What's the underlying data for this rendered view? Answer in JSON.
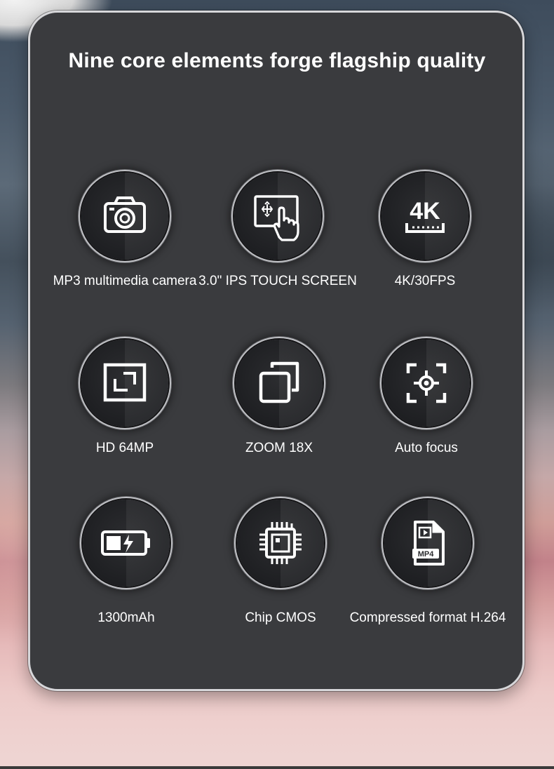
{
  "title": "Nine core elements forge flagship quality",
  "features": [
    {
      "label": "MP3 multimedia camera",
      "icon": "camera-icon"
    },
    {
      "label": "3.0\" IPS TOUCH SCREEN",
      "icon": "touch-screen-icon"
    },
    {
      "label": "4K/30FPS",
      "icon": "4k-icon"
    },
    {
      "label": "HD 64MP",
      "icon": "frame-icon"
    },
    {
      "label": "ZOOM 18X",
      "icon": "zoom-icon"
    },
    {
      "label": "Auto focus",
      "icon": "focus-icon"
    },
    {
      "label": "1300mAh",
      "icon": "battery-icon"
    },
    {
      "label": "Chip CMOS",
      "icon": "chip-icon"
    },
    {
      "label": "Compressed format H.264",
      "icon": "mp4-file-icon"
    }
  ],
  "icon_texts": {
    "four_k": "4K",
    "mp4": "MP4"
  },
  "colors": {
    "panel": "#3a3b3e",
    "panel_border": "#d7d7da",
    "text": "#ffffff"
  }
}
